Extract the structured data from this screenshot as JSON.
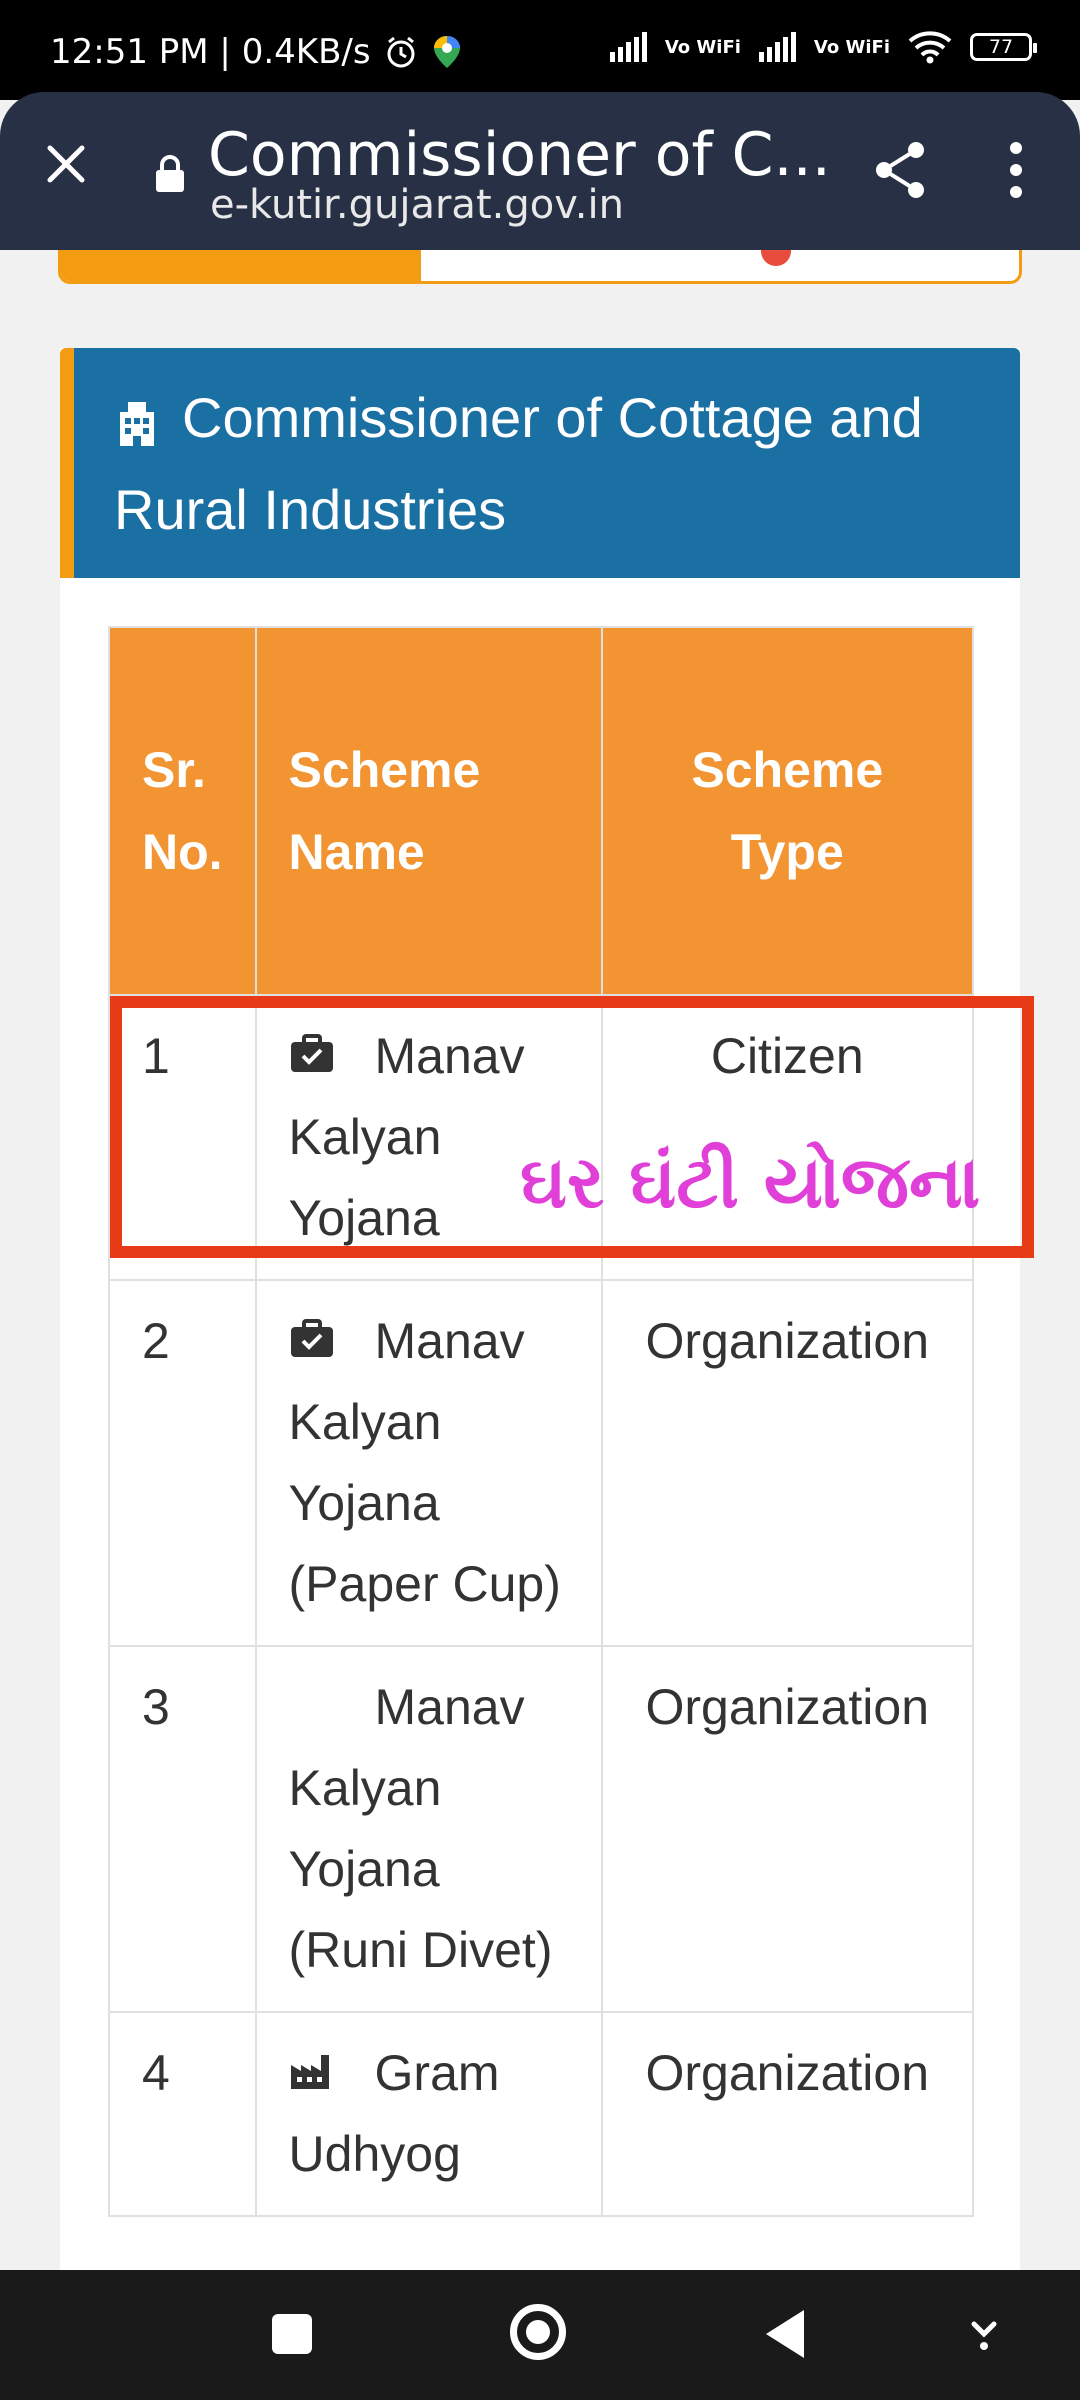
{
  "status_bar": {
    "time": "12:51 PM | 0.4KB/s",
    "vowifi_1": "Vo WiFi",
    "vowifi_2": "Vo WiFi",
    "battery": "77"
  },
  "browser": {
    "title": "Commissioner of C...",
    "url": "e-kutir.gujarat.gov.in",
    "icons": [
      "close-icon",
      "lock-icon",
      "share-icon",
      "more-vert-icon"
    ]
  },
  "card": {
    "title": "Commissioner of Cottage and Rural Industries",
    "icon": "building-icon",
    "accent_color": "#1a6fa3",
    "border_color": "#f39c12"
  },
  "table": {
    "headers": {
      "sr": "Sr. No.",
      "name": "Scheme Name",
      "type": "Scheme Type"
    },
    "header_color": "#f39433",
    "rows": [
      {
        "sr": "1",
        "name": "Manav Kalyan Yojana",
        "type": "Citizen",
        "icon": "briefcase-check-icon"
      },
      {
        "sr": "2",
        "name": "Manav Kalyan Yojana (Paper Cup)",
        "type": "Organization",
        "icon": "briefcase-check-icon"
      },
      {
        "sr": "3",
        "name": "Manav Kalyan Yojana (Runi Divet)",
        "type": "Organization",
        "icon": ""
      },
      {
        "sr": "4",
        "name": "Gram Udhyog",
        "type": "Organization",
        "icon": "factory-icon"
      }
    ]
  },
  "overlay": {
    "text": "ઘર ઘંટી યોજના",
    "text_color": "#e040d8",
    "box_color": "#e73a17"
  },
  "nav_bar": {
    "icons": [
      "recents-square-icon",
      "home-circle-icon",
      "back-triangle-icon",
      "keyboard-hide-icon"
    ]
  }
}
